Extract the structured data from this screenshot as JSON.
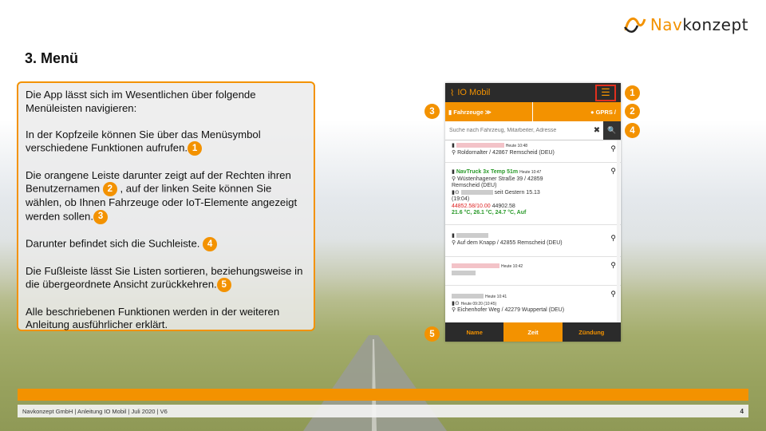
{
  "logo": {
    "prefix": "Nav",
    "suffix": "konzept"
  },
  "page_title": "3. Menü",
  "text": {
    "p1": "Die App lässt sich im Wesentlichen über folgende Menüleisten navigieren:",
    "p2": "In der Kopfzeile können Sie über das Menüsymbol verschiedene Funktionen aufrufen.",
    "p3a": "Die orangene Leiste darunter zeigt auf der Rechten ihren Benutzernamen",
    "p3b": ", auf der linken Seite können Sie wählen, ob Ihnen Fahrzeuge oder IoT-Elemente angezeigt werden sollen.",
    "p4": "Darunter befindet sich die Suchleiste.",
    "p5": "Die Fußleiste lässt Sie Listen sortieren, beziehungsweise in die übergeordnete Ansicht zurückkehren.",
    "p6": "Alle beschriebenen Funktionen werden in der weiteren Anleitung ausführlicher erklärt."
  },
  "badges": {
    "b1": "1",
    "b2": "2",
    "b3": "3",
    "b4": "4",
    "b5": "5"
  },
  "phone": {
    "app_title": "IO Mobil",
    "menu_icon": "hamburger-icon",
    "left_label": "Fahrzeuge ≫",
    "right_label": "GPRS / ",
    "search_placeholder": "Suche nach Fahrzeug, Mitarbeiter, Adresse",
    "clear_label": "✖",
    "search_icon": "🔍",
    "items": [
      {
        "time": "Heute 10:48",
        "address": "Roldornalter / 42867 Remscheid (DEU)"
      },
      {
        "name": "NavTruck 3x Temp 51m",
        "time": "Heute 10:47",
        "address1": "Wüstenhagener Straße 39 / 42859",
        "address2": "Remscheid (DEU)",
        "since": "seit Gestern 15.13",
        "since2": "(19:04)",
        "temp1": "44852.58/10.00",
        "temp1b": "44902.58",
        "temp2": "21.6 °C, 26.1 °C, 24.7 °C, Auf"
      },
      {
        "address": "Auf dem Knapp / 42855 Remscheid (DEU)"
      },
      {
        "time": "Heute 10:42"
      },
      {
        "time": "Heute 10:41",
        "time2": "Heute 09:20 (10:45)",
        "address": "Eichenhofer Weg / 42279 Wuppertal (DEU)"
      }
    ],
    "footer": [
      "Name",
      "Zeit",
      "Zündung"
    ]
  },
  "footer": {
    "text": "Navkonzept GmbH  |  Anleitung IO Mobil  |  Juli 2020  |  V6",
    "page": "4"
  },
  "colors": {
    "accent": "#f39200",
    "highlight": "#e1301e"
  }
}
